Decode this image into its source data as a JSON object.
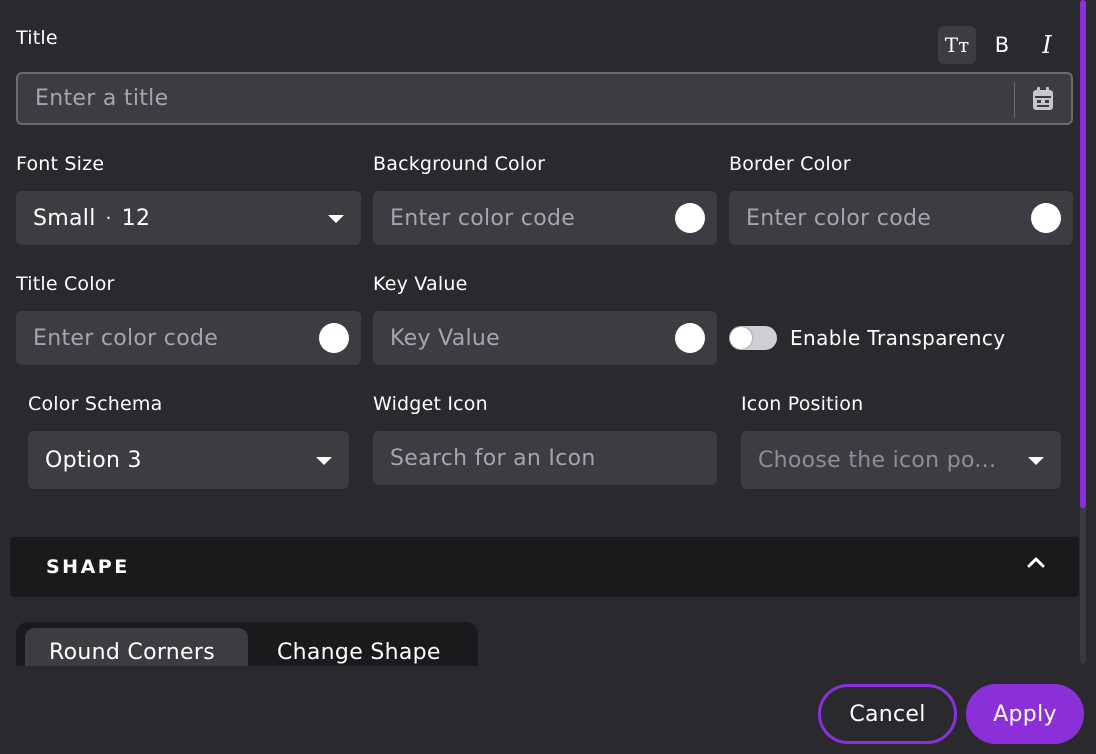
{
  "title_section": {
    "label": "Title",
    "placeholder": "Enter a title",
    "format_buttons": {
      "text_size": "Tт",
      "bold": "B",
      "italic": "I"
    }
  },
  "font_size": {
    "label": "Font Size",
    "value": "Small",
    "separator": "·",
    "size": "12"
  },
  "background_color": {
    "label": "Background Color",
    "placeholder": "Enter color code"
  },
  "border_color": {
    "label": "Border Color",
    "placeholder": "Enter color code"
  },
  "title_color": {
    "label": "Title Color",
    "placeholder": "Enter color code"
  },
  "key_value": {
    "label": "Key Value",
    "placeholder": "Key Value"
  },
  "transparency": {
    "label": "Enable Transparency",
    "enabled": false
  },
  "color_schema": {
    "label": "Color Schema",
    "value": "Option 3"
  },
  "widget_icon": {
    "label": "Widget Icon",
    "placeholder": "Search for an Icon"
  },
  "icon_position": {
    "label": "Icon Position",
    "placeholder": "Choose the icon po..."
  },
  "shape_section": {
    "title": "SHAPE",
    "tabs": [
      {
        "label": "Round Corners",
        "active": true
      },
      {
        "label": "Change Shape",
        "active": false
      }
    ]
  },
  "footer": {
    "cancel_label": "Cancel",
    "apply_label": "Apply"
  },
  "colors": {
    "background": "#2a2a2e",
    "input": "#3d3c42",
    "accent": "#8b2fd9",
    "section_header": "#1a1a1c",
    "swatch": "#ffffff"
  }
}
